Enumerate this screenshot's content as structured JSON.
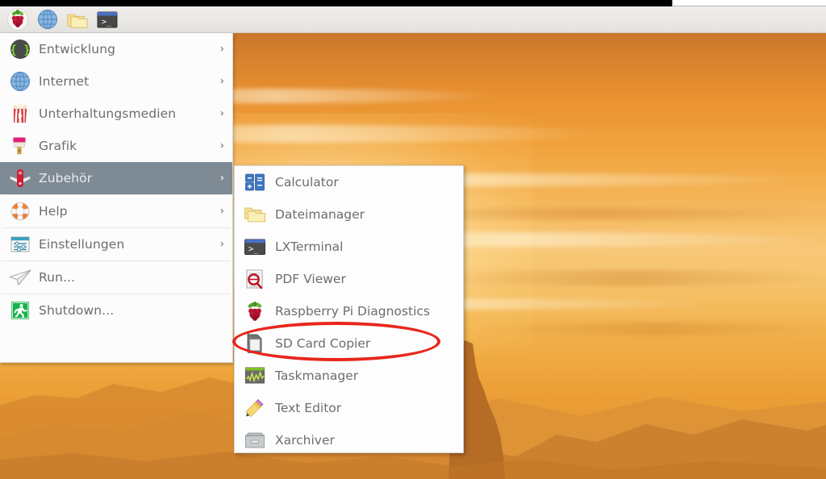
{
  "desktop": {
    "wallpaper_description": "sunset over mountain ridges",
    "sky_top_color": "#c9762c",
    "sky_glow_color": "#fff8e0",
    "ridge_color": "#d98b33"
  },
  "panel": {
    "buttons": [
      {
        "name": "raspberry-menu-icon",
        "label": "Menu",
        "icon": "raspberry-icon"
      },
      {
        "name": "web-browser-icon",
        "label": "Web Browser",
        "icon": "globe-icon"
      },
      {
        "name": "file-manager-icon",
        "label": "File Manager",
        "icon": "folder-icon"
      },
      {
        "name": "terminal-icon",
        "label": "Terminal",
        "icon": "terminal-icon"
      }
    ]
  },
  "main_menu": {
    "selected": "Zubehör",
    "items": [
      {
        "label": "Entwicklung",
        "icon": "code-braces-icon",
        "has_submenu": true,
        "arrow": "›",
        "separator_after": false
      },
      {
        "label": "Internet",
        "icon": "globe-icon",
        "has_submenu": true,
        "arrow": "›",
        "separator_after": false
      },
      {
        "label": "Unterhaltungsmedien",
        "icon": "popcorn-icon",
        "has_submenu": true,
        "arrow": "›",
        "separator_after": false
      },
      {
        "label": "Grafik",
        "icon": "paintbrush-icon",
        "has_submenu": true,
        "arrow": "›",
        "separator_after": false
      },
      {
        "label": "Zubehör",
        "icon": "swiss-knife-icon",
        "has_submenu": true,
        "arrow": "›",
        "separator_after": true
      },
      {
        "label": "Help",
        "icon": "lifebuoy-icon",
        "has_submenu": true,
        "arrow": "›",
        "separator_after": true
      },
      {
        "label": "Einstellungen",
        "icon": "preferences-icon",
        "has_submenu": true,
        "arrow": "›",
        "separator_after": true
      },
      {
        "label": "Run...",
        "icon": "paper-plane-icon",
        "has_submenu": false,
        "arrow": "",
        "separator_after": true
      },
      {
        "label": "Shutdown...",
        "icon": "exit-runner-icon",
        "has_submenu": false,
        "arrow": "",
        "separator_after": false
      }
    ]
  },
  "submenu": {
    "parent": "Zubehör",
    "highlighted_item": "SD Card Copier",
    "highlight_color": "#e8261c",
    "items": [
      {
        "label": "Calculator",
        "icon": "calculator-icon"
      },
      {
        "label": "Dateimanager",
        "icon": "folders-icon"
      },
      {
        "label": "LXTerminal",
        "icon": "terminal-icon"
      },
      {
        "label": "PDF Viewer",
        "icon": "pdf-magnifier-icon"
      },
      {
        "label": "Raspberry Pi Diagnostics",
        "icon": "raspberry-icon"
      },
      {
        "label": "SD Card Copier",
        "icon": "sd-card-icon"
      },
      {
        "label": "Taskmanager",
        "icon": "task-graph-icon"
      },
      {
        "label": "Text Editor",
        "icon": "pencil-icon"
      },
      {
        "label": "Xarchiver",
        "icon": "archive-box-icon"
      }
    ]
  }
}
